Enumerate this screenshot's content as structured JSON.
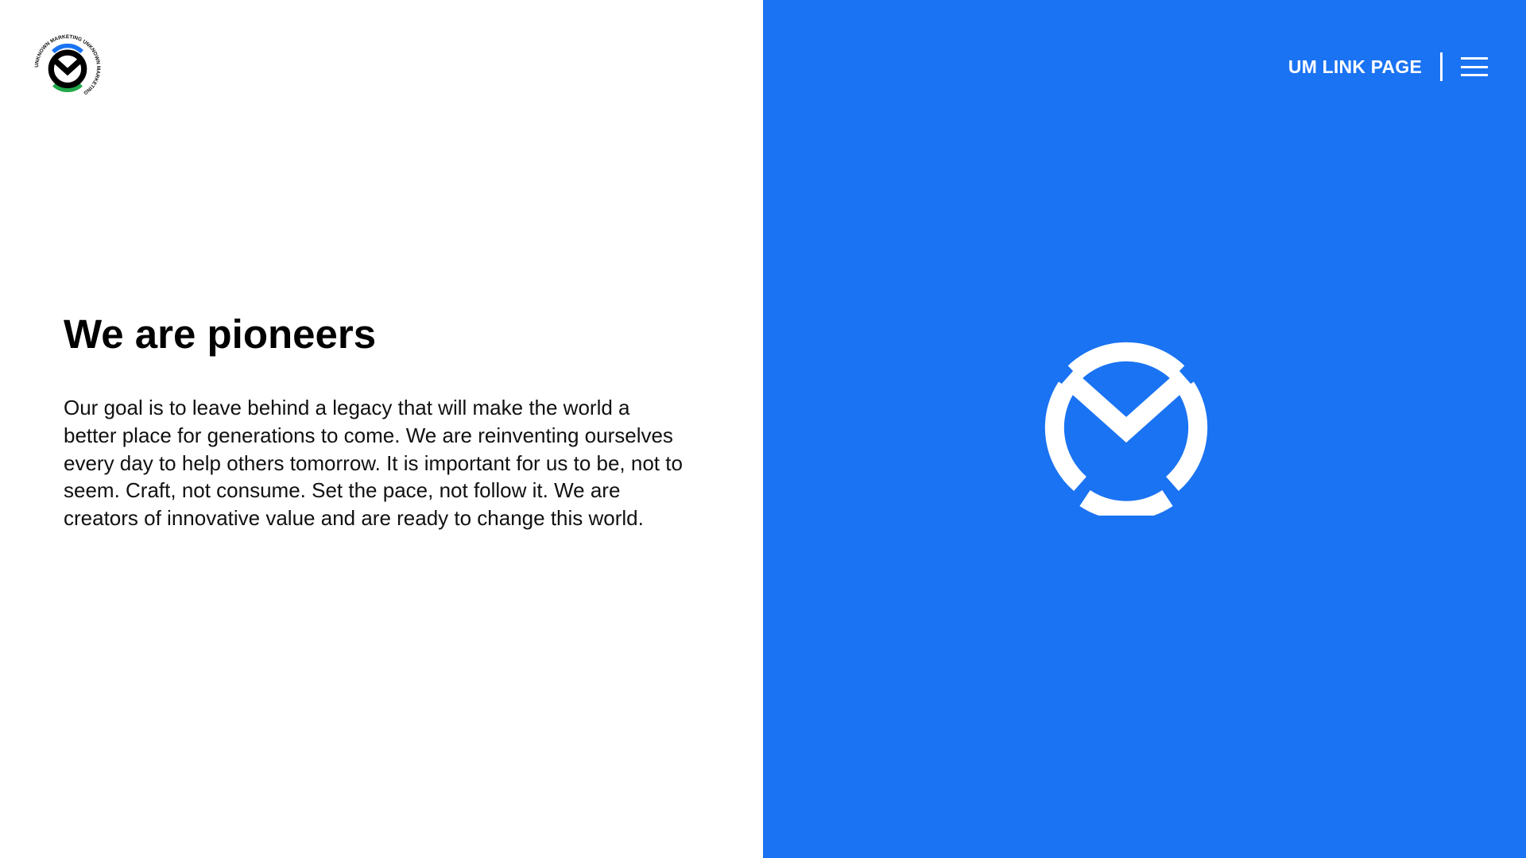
{
  "brand": {
    "logo_ring_text": "UNKNOWN MARKETING UNKNOWN MARKETING",
    "accent_blue": "#1a73f2",
    "accent_green": "#22a84a"
  },
  "header": {
    "link_label": "UM LINK PAGE"
  },
  "main": {
    "title": "We are pioneers",
    "paragraph": "Our goal is to leave behind a legacy that will make the world a better place for generations to come. We are reinventing ourselves every day to help others tomorrow. It is important for us to be, not to seem. Craft, not consume. Set the pace, not follow it. We are creators of innovative value and are ready to change this world."
  },
  "icons": {
    "menu": "hamburger-menu-icon",
    "logo": "um-logo-icon",
    "mark": "um-mark-icon"
  }
}
